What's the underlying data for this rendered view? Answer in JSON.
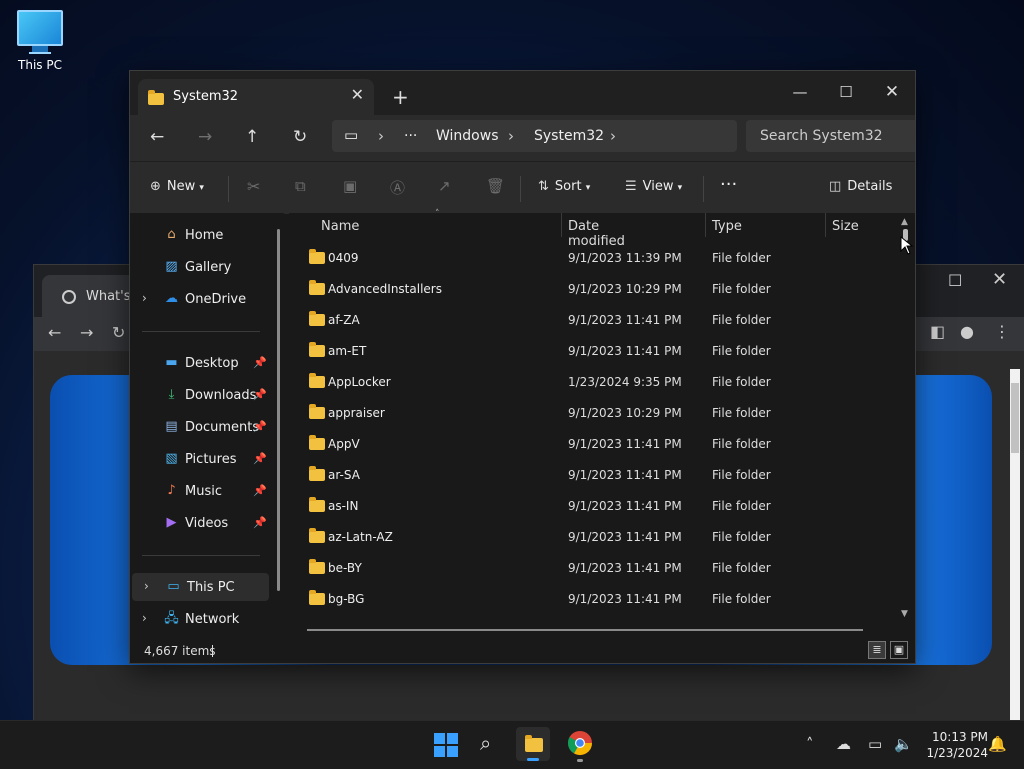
{
  "desktop": {
    "icon_label": "This PC"
  },
  "chrome": {
    "tab_title": "What's Ne"
  },
  "explorer": {
    "tab_title": "System32",
    "breadcrumb": [
      "Windows",
      "System32"
    ],
    "search_placeholder": "Search System32",
    "toolbar": {
      "new": "New",
      "sort": "Sort",
      "view": "View",
      "details": "Details"
    },
    "nav": {
      "top": [
        "Home",
        "Gallery",
        "OneDrive"
      ],
      "pinned": [
        "Desktop",
        "Downloads",
        "Documents",
        "Pictures",
        "Music",
        "Videos"
      ],
      "bottom": [
        "This PC",
        "Network"
      ]
    },
    "columns": {
      "name": "Name",
      "date": "Date modified",
      "type": "Type",
      "size": "Size"
    },
    "rows": [
      {
        "name": "0409",
        "date": "9/1/2023 11:39 PM",
        "type": "File folder"
      },
      {
        "name": "AdvancedInstallers",
        "date": "9/1/2023 10:29 PM",
        "type": "File folder"
      },
      {
        "name": "af-ZA",
        "date": "9/1/2023 11:41 PM",
        "type": "File folder"
      },
      {
        "name": "am-ET",
        "date": "9/1/2023 11:41 PM",
        "type": "File folder"
      },
      {
        "name": "AppLocker",
        "date": "1/23/2024 9:35 PM",
        "type": "File folder"
      },
      {
        "name": "appraiser",
        "date": "9/1/2023 10:29 PM",
        "type": "File folder"
      },
      {
        "name": "AppV",
        "date": "9/1/2023 11:41 PM",
        "type": "File folder"
      },
      {
        "name": "ar-SA",
        "date": "9/1/2023 11:41 PM",
        "type": "File folder"
      },
      {
        "name": "as-IN",
        "date": "9/1/2023 11:41 PM",
        "type": "File folder"
      },
      {
        "name": "az-Latn-AZ",
        "date": "9/1/2023 11:41 PM",
        "type": "File folder"
      },
      {
        "name": "be-BY",
        "date": "9/1/2023 11:41 PM",
        "type": "File folder"
      },
      {
        "name": "bg-BG",
        "date": "9/1/2023 11:41 PM",
        "type": "File folder"
      }
    ],
    "status": "4,667 items"
  },
  "taskbar": {
    "time": "10:13 PM",
    "date": "1/23/2024"
  },
  "colors": {
    "folder": "#f3c140",
    "accent": "#3aa0ff",
    "window_bg": "#191919",
    "chrome_bg": "#202124"
  }
}
